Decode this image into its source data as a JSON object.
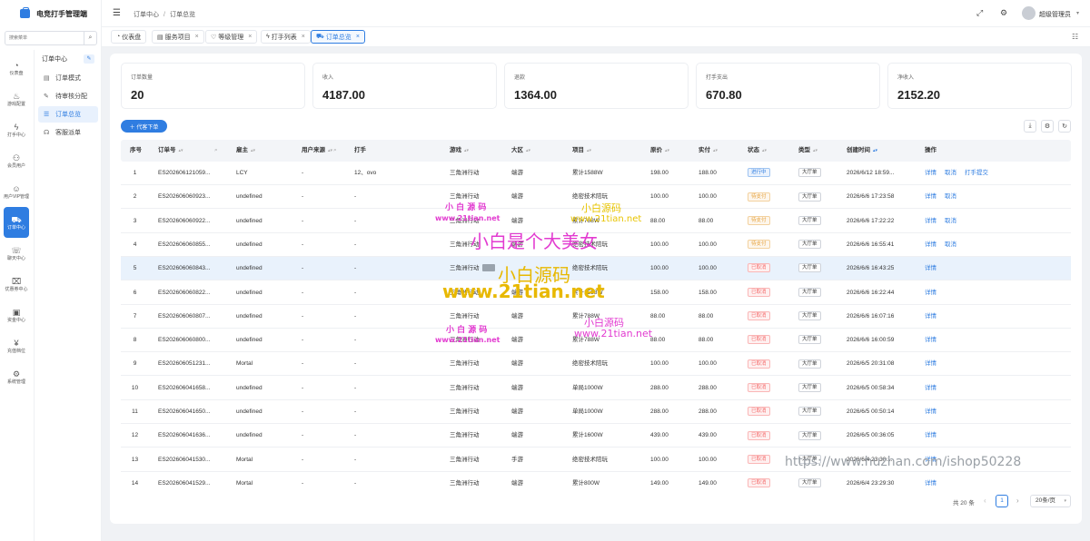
{
  "app": {
    "title": "电竞打手管理端"
  },
  "sidebar": {
    "search_placeholder": "搜索菜单",
    "search_icon": "⌕",
    "rail": [
      {
        "icon": "◔",
        "label": "仪表盘",
        "active": false
      },
      {
        "icon": "♨",
        "label": "游戏配置",
        "active": false
      },
      {
        "icon": "ϟ",
        "label": "打手中心",
        "active": false
      },
      {
        "icon": "⚇",
        "label": "会员用户",
        "active": false
      },
      {
        "icon": "☺",
        "label": "用户VIP管理",
        "active": false
      },
      {
        "icon": "⛟",
        "label": "订单中心",
        "active": true
      },
      {
        "icon": "☏",
        "label": "聊天中心",
        "active": false
      },
      {
        "icon": "⌧",
        "label": "优惠券中心",
        "active": false
      },
      {
        "icon": "▣",
        "label": "资金中心",
        "active": false
      },
      {
        "icon": "¥",
        "label": "充值档位",
        "active": false
      },
      {
        "icon": "⚙",
        "label": "系统管理",
        "active": false
      }
    ],
    "submenu": {
      "title": "订单中心",
      "pin_icon": "✎",
      "items": [
        {
          "icon": "▤",
          "label": "订单模式",
          "active": false
        },
        {
          "icon": "✎",
          "label": "待审核分配",
          "active": false
        },
        {
          "icon": "☰",
          "label": "订单总览",
          "active": true
        },
        {
          "icon": "☊",
          "label": "客服派单",
          "active": false
        }
      ]
    }
  },
  "header": {
    "fold_icon": "☰",
    "breadcrumb": [
      "订单中心",
      "订单总览"
    ],
    "fullscreen_icon": "⤢",
    "settings_icon": "⚙",
    "user_name": "超级管理员",
    "user_arrow": "▾"
  },
  "tabs": [
    {
      "icon": "◔",
      "label": "仪表盘",
      "closable": false,
      "active": false
    },
    {
      "icon": "▤",
      "label": "服务项目",
      "closable": true,
      "active": false
    },
    {
      "icon": "♡",
      "label": "等级管理",
      "closable": true,
      "active": false
    },
    {
      "icon": "ϟ",
      "label": "打手列表",
      "closable": true,
      "active": false
    },
    {
      "icon": "⛟",
      "label": "订单总览",
      "closable": true,
      "active": true
    }
  ],
  "tab_close": "×",
  "tab_menu_icon": "☷",
  "stats": [
    {
      "label": "订单数量",
      "value": "20"
    },
    {
      "label": "收入",
      "value": "4187.00"
    },
    {
      "label": "退款",
      "value": "1364.00"
    },
    {
      "label": "打手支出",
      "value": "670.80"
    },
    {
      "label": "净收入",
      "value": "2152.20"
    }
  ],
  "toolbar": {
    "add_label": "＋ 代客下单",
    "download_icon": "⤓",
    "setting_icon": "⚙",
    "refresh_icon": "↻"
  },
  "table": {
    "columns": [
      {
        "key": "idx",
        "label": "序号",
        "sort": false,
        "filter": false
      },
      {
        "key": "order_no",
        "label": "订单号",
        "sort": true,
        "filter": true
      },
      {
        "key": "employer",
        "label": "雇主",
        "sort": true,
        "filter": false
      },
      {
        "key": "source",
        "label": "用户来源",
        "sort": true,
        "filter": true
      },
      {
        "key": "player",
        "label": "打手",
        "sort": false,
        "filter": false
      },
      {
        "key": "game",
        "label": "游戏",
        "sort": true,
        "filter": false
      },
      {
        "key": "region",
        "label": "大区",
        "sort": true,
        "filter": false
      },
      {
        "key": "item",
        "label": "项目",
        "sort": true,
        "filter": false
      },
      {
        "key": "price",
        "label": "原价",
        "sort": true,
        "filter": false
      },
      {
        "key": "paid",
        "label": "实付",
        "sort": true,
        "filter": false
      },
      {
        "key": "status",
        "label": "状态",
        "sort": true,
        "filter": false
      },
      {
        "key": "type",
        "label": "类型",
        "sort": true,
        "filter": false
      },
      {
        "key": "created",
        "label": "创建时间",
        "sort": true,
        "filter": false
      },
      {
        "key": "ops",
        "label": "操作",
        "sort": false,
        "filter": false
      }
    ],
    "sort_icon": "▴▾",
    "filter_icon": "⌕",
    "rows": [
      {
        "idx": "1",
        "order_no": "ES202606121059...",
        "employer": "LCY",
        "source": "-",
        "player": "12、ovo",
        "game": "三角洲行动",
        "region": "端游",
        "item": "累计1588W",
        "price": "198.00",
        "paid": "188.00",
        "status": "进行中",
        "status_color": "blue",
        "type": "大厅单",
        "created": "2026/6/12 18:59...",
        "ops": [
          "详情",
          "取消",
          "打手提交"
        ]
      },
      {
        "idx": "2",
        "order_no": "ES202606060923...",
        "employer": "undefined",
        "source": "-",
        "player": "-",
        "game": "三角洲行动",
        "region": "端游",
        "item": "绝密技术陪玩",
        "price": "100.00",
        "paid": "100.00",
        "status": "待支付",
        "status_color": "orange",
        "type": "大厅单",
        "created": "2026/6/6 17:23:58",
        "ops": [
          "详情",
          "取消"
        ]
      },
      {
        "idx": "3",
        "order_no": "ES202606060922...",
        "employer": "undefined",
        "source": "-",
        "player": "-",
        "game": "三角洲行动",
        "region": "端游",
        "item": "累计788W",
        "price": "88.00",
        "paid": "88.00",
        "status": "待支付",
        "status_color": "orange",
        "type": "大厅单",
        "created": "2026/6/6 17:22:22",
        "ops": [
          "详情",
          "取消"
        ]
      },
      {
        "idx": "4",
        "order_no": "ES202606060855...",
        "employer": "undefined",
        "source": "-",
        "player": "-",
        "game": "三角洲行动",
        "region": "端游",
        "item": "绝密技术陪玩",
        "price": "100.00",
        "paid": "100.00",
        "status": "待支付",
        "status_color": "orange",
        "type": "大厅单",
        "created": "2026/6/6 16:55:41",
        "ops": [
          "详情",
          "取消"
        ]
      },
      {
        "idx": "5",
        "order_no": "ES202606060843...",
        "employer": "undefined",
        "source": "-",
        "player": "-",
        "game": "三角洲行动",
        "region": "",
        "item": "绝密技术陪玩",
        "price": "100.00",
        "paid": "100.00",
        "status": "已取消",
        "status_color": "red",
        "type": "大厅单",
        "created": "2026/6/6 16:43:25",
        "ops": [
          "详情"
        ],
        "highlight": true,
        "blocked": true
      },
      {
        "idx": "6",
        "order_no": "ES202606060822...",
        "employer": "undefined",
        "source": "-",
        "player": "-",
        "game": "三角洲行动",
        "region": "端游",
        "item": "累计1588W",
        "price": "158.00",
        "paid": "158.00",
        "status": "已取消",
        "status_color": "red",
        "type": "大厅单",
        "created": "2026/6/6 16:22:44",
        "ops": [
          "详情"
        ]
      },
      {
        "idx": "7",
        "order_no": "ES202606060807...",
        "employer": "undefined",
        "source": "-",
        "player": "-",
        "game": "三角洲行动",
        "region": "端游",
        "item": "累计788W",
        "price": "88.00",
        "paid": "88.00",
        "status": "已取消",
        "status_color": "red",
        "type": "大厅单",
        "created": "2026/6/6 16:07:16",
        "ops": [
          "详情"
        ]
      },
      {
        "idx": "8",
        "order_no": "ES202606060800...",
        "employer": "undefined",
        "source": "-",
        "player": "-",
        "game": "三角洲行动",
        "region": "端游",
        "item": "累计788W",
        "price": "88.00",
        "paid": "88.00",
        "status": "已取消",
        "status_color": "red",
        "type": "大厅单",
        "created": "2026/6/6 16:00:59",
        "ops": [
          "详情"
        ]
      },
      {
        "idx": "9",
        "order_no": "ES202606051231...",
        "employer": "Mortal",
        "source": "-",
        "player": "-",
        "game": "三角洲行动",
        "region": "端游",
        "item": "绝密技术陪玩",
        "price": "100.00",
        "paid": "100.00",
        "status": "已取消",
        "status_color": "red",
        "type": "大厅单",
        "created": "2026/6/5 20:31:08",
        "ops": [
          "详情"
        ]
      },
      {
        "idx": "10",
        "order_no": "ES202606041658...",
        "employer": "undefined",
        "source": "-",
        "player": "-",
        "game": "三角洲行动",
        "region": "端游",
        "item": "单局1000W",
        "price": "288.00",
        "paid": "288.00",
        "status": "已取消",
        "status_color": "red",
        "type": "大厅单",
        "created": "2026/6/5 00:58:34",
        "ops": [
          "详情"
        ]
      },
      {
        "idx": "11",
        "order_no": "ES202606041650...",
        "employer": "undefined",
        "source": "-",
        "player": "-",
        "game": "三角洲行动",
        "region": "端游",
        "item": "单局1000W",
        "price": "288.00",
        "paid": "288.00",
        "status": "已取消",
        "status_color": "red",
        "type": "大厅单",
        "created": "2026/6/5 00:50:14",
        "ops": [
          "详情"
        ]
      },
      {
        "idx": "12",
        "order_no": "ES202606041636...",
        "employer": "undefined",
        "source": "-",
        "player": "-",
        "game": "三角洲行动",
        "region": "端游",
        "item": "累计1600W",
        "price": "439.00",
        "paid": "439.00",
        "status": "已取消",
        "status_color": "red",
        "type": "大厅单",
        "created": "2026/6/5 00:36:05",
        "ops": [
          "详情"
        ]
      },
      {
        "idx": "13",
        "order_no": "ES202606041530...",
        "employer": "Mortal",
        "source": "-",
        "player": "-",
        "game": "三角洲行动",
        "region": "手游",
        "item": "绝密技术陪玩",
        "price": "100.00",
        "paid": "100.00",
        "status": "已取消",
        "status_color": "red",
        "type": "大厅单",
        "created": "2026/6/4 23:30:...",
        "ops": [
          "详情"
        ]
      },
      {
        "idx": "14",
        "order_no": "ES202606041529...",
        "employer": "Mortal",
        "source": "-",
        "player": "-",
        "game": "三角洲行动",
        "region": "端游",
        "item": "累计800W",
        "price": "149.00",
        "paid": "149.00",
        "status": "已取消",
        "status_color": "red",
        "type": "大厅单",
        "created": "2026/6/4 23:29:30",
        "ops": [
          "详情"
        ]
      }
    ]
  },
  "pagination": {
    "total": "共 20 条",
    "prev": "‹",
    "current": "1",
    "next": "›",
    "page_size": "20条/页",
    "size_arrow": "▾"
  },
  "watermarks": [
    {
      "text": "小 白 源 码",
      "color": "#e23bd0"
    },
    {
      "text": "www.21tian.net",
      "color": "#e23bd0"
    },
    {
      "text": "小白源码",
      "color": "#e8c400"
    },
    {
      "text": "www.21tian.net",
      "color": "#e8c400"
    },
    {
      "text": "小白是个大美女",
      "color": "#e23bd0"
    },
    {
      "text": "小白源码",
      "color": "#e8b800"
    },
    {
      "text": "www.21tian.net",
      "color": "#e8b800"
    },
    {
      "text": "小 白 源 码",
      "color": "#e23bd0"
    },
    {
      "text": "www.21tian.net",
      "color": "#e23bd0"
    },
    {
      "text": "小白源码",
      "color": "#e23bd0"
    },
    {
      "text": "www.21tian.net",
      "color": "#e23bd0"
    },
    {
      "text": "https://www.huzhan.com/ishop50228",
      "color": "#9aa0a6"
    }
  ],
  "colors": {
    "primary": "#2f7de1",
    "warning": "#e6a23c",
    "danger": "#f56c6c"
  }
}
